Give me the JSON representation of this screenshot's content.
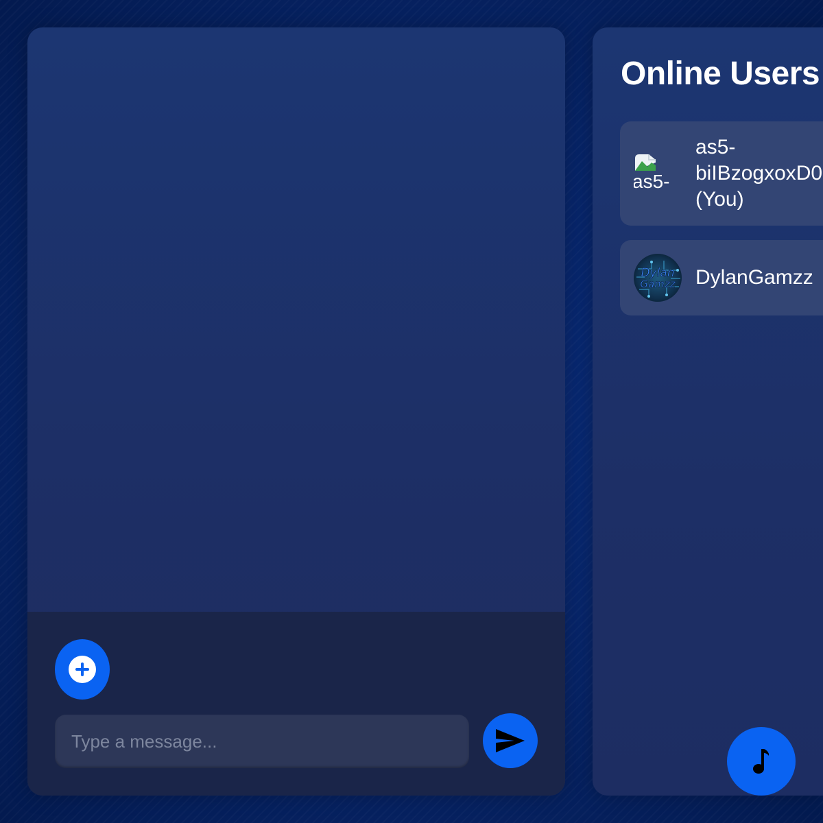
{
  "chat": {
    "attach_icon": "plus-circle-icon",
    "input": {
      "placeholder": "Type a message...",
      "value": ""
    },
    "send_icon": "send-icon"
  },
  "users": {
    "title": "Online Users",
    "list": [
      {
        "name_lines": [
          "as5-",
          "biIBzogxoxD0",
          "(You)"
        ],
        "avatar_alt": "as5-",
        "avatar_state": "broken-image"
      },
      {
        "name_lines": [
          "DylanGamzz"
        ],
        "avatar_text": [
          "Dylan",
          "Gamzz"
        ],
        "avatar_state": "image"
      }
    ]
  },
  "music": {
    "icon": "music-note-icon"
  },
  "colors": {
    "accent": "#0a63f2",
    "panel": "#1d2f66",
    "card": "#334574",
    "input_bg": "#2d3758",
    "footer_bg": "#1a2549"
  }
}
